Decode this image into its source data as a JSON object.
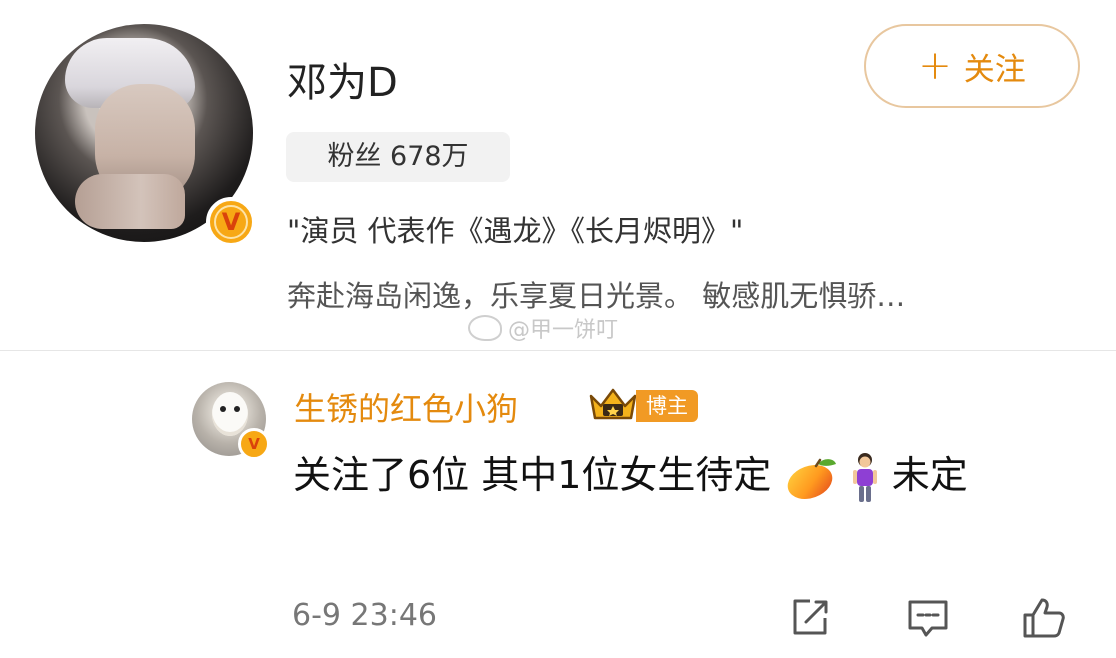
{
  "profile": {
    "name": "邓为D",
    "fans_label": "粉丝 678万",
    "description": "\"演员 代表作《遇龙》《长月烬明》\"",
    "intro": "奔赴海岛闲逸，乐享夏日光景。 敏感肌无惧骄…",
    "verified_badge": "V",
    "follow_button": {
      "plus": "+",
      "label": "关注"
    }
  },
  "watermark": "@甲一饼叮",
  "comment": {
    "author": "生锈的红色小狗",
    "verified_badge": "V",
    "author_tag": "博主",
    "text": "关注了6位 其中1位女生待定",
    "text_tail": "未定",
    "timestamp": "6-9 23:46"
  },
  "icons": {
    "repost": "repost-icon",
    "comment": "comment-icon",
    "like": "like-icon",
    "crown": "crown-icon",
    "mango": "mango-emoji",
    "woman": "woman-emoji"
  },
  "colors": {
    "accent": "#e48a0e",
    "badge": "#f7a815",
    "tag": "#f19a24"
  }
}
